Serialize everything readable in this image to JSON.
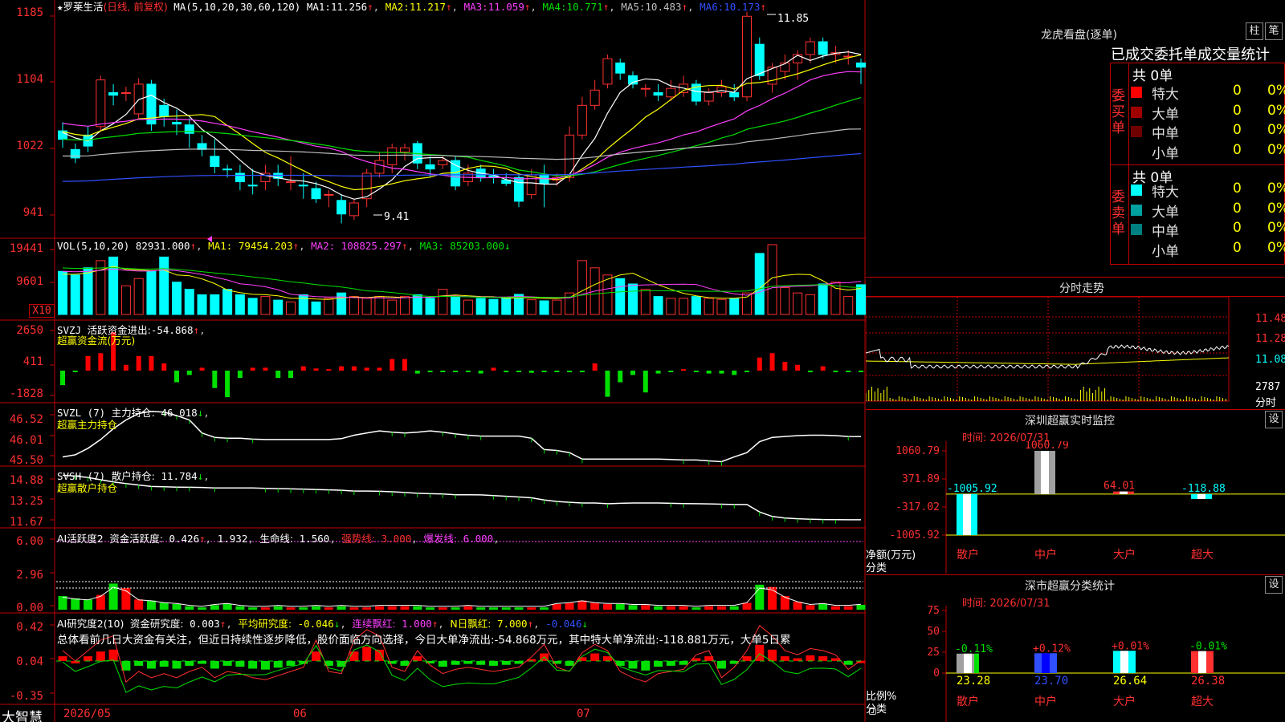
{
  "stock": {
    "star": "★",
    "name": "罗莱生活",
    "period": "(日线, 前复权)",
    "ma_params": "MA(5,10,20,30,60,120)",
    "ma": [
      {
        "label": "MA1:",
        "value": "11.256",
        "arrow": "↑",
        "color": "#ffffff"
      },
      {
        "label": "MA2:",
        "value": "11.217",
        "arrow": "↑",
        "color": "#ffff00"
      },
      {
        "label": "MA3:",
        "value": "11.059",
        "arrow": "↑",
        "color": "#ff40ff"
      },
      {
        "label": "MA4:",
        "value": "10.771",
        "arrow": "↑",
        "color": "#00e000"
      },
      {
        "label": "MA5:",
        "value": "10.483",
        "arrow": "↑",
        "color": "#c0c0c0"
      },
      {
        "label": "MA6:",
        "value": "10.173",
        "arrow": "↑",
        "color": "#3050ff"
      }
    ],
    "high_marker": "11.85",
    "low_marker": "9.41"
  },
  "price_axis": [
    "1185",
    "1104",
    "1022",
    "941"
  ],
  "vol": {
    "header": "VOL(5,10,20)",
    "value": "82931.000",
    "ma1": "79454.203",
    "ma2": "108825.297",
    "ma3": "85203.000",
    "axis": [
      "19441",
      "9601"
    ],
    "unit": "X10"
  },
  "svzj": {
    "header": "SVZJ",
    "label": "活跃资金进出:",
    "value": "-54.868",
    "sub": "超赢资金流(万元)",
    "axis": [
      "2650",
      "411",
      "-1828"
    ]
  },
  "svzl": {
    "header": "SVZL (7)",
    "label": "主力持仓:",
    "value": "46.018",
    "sub": "超赢主力持仓",
    "axis": [
      "46.52",
      "46.01",
      "45.50"
    ]
  },
  "svsh": {
    "header": "SVSH (7)",
    "label": "散户持仓:",
    "value": "11.784",
    "sub": "超赢散户持仓",
    "axis": [
      "14.88",
      "13.25",
      "11.67"
    ]
  },
  "ai_active": {
    "header": "AI活跃度2",
    "label": "资金活跃度:",
    "v1": "0.426",
    "v2": "1.932",
    "life_label": "生命线:",
    "life": "1.560",
    "strong_label": "强势线:",
    "strong": "3.000",
    "burst_label": "爆发线:",
    "burst": "6.000",
    "axis": [
      "6.00",
      "2.96",
      "0.00"
    ]
  },
  "ai_research": {
    "header": "AI研究度2(10)",
    "label": "资金研究度:",
    "v1": "0.003",
    "avg_label": "平均研究度:",
    "avg": "-0.046",
    "red_label": "连续飘红:",
    "red": "1.000",
    "nday_label": "N日飘红:",
    "nday": "7.000",
    "last": "-0.046",
    "comment": "总体看前几日大资金有关注，但近日持续性逐步降低，股价面临方向选择，今日大单净流出:-54.868万元，其中特大单净流出:-118.881万元，大单5日累",
    "axis": [
      "0.42",
      "0.04",
      "-0.35"
    ]
  },
  "date_axis": {
    "brand": "大智慧",
    "labels": [
      "2026/05",
      "06",
      "07"
    ]
  },
  "dragon": {
    "title": "龙虎看盘(逐单)",
    "btn1": "柱",
    "btn2": "笔",
    "tabs": "已成交委托单成交量统计",
    "buy_side": "委买单",
    "sell_side": "委卖单",
    "buy_total": "共 0单",
    "sell_total": "共 0单",
    "buy_rows": [
      {
        "name": "特大",
        "count": "0",
        "pct": "0%",
        "color": "#ff0000"
      },
      {
        "name": "大单",
        "count": "0",
        "pct": "0%",
        "color": "#a00000"
      },
      {
        "name": "中单",
        "count": "0",
        "pct": "0%",
        "color": "#700000"
      },
      {
        "name": "小单",
        "count": "0",
        "pct": "0%",
        "color": "#000000"
      }
    ],
    "sell_rows": [
      {
        "name": "特大",
        "count": "0",
        "pct": "0%",
        "color": "#00ffff"
      },
      {
        "name": "大单",
        "count": "0",
        "pct": "0%",
        "color": "#00a0a0"
      },
      {
        "name": "中单",
        "count": "0",
        "pct": "0%",
        "color": "#008080"
      },
      {
        "name": "小单",
        "count": "0",
        "pct": "0%",
        "color": "#000000"
      }
    ]
  },
  "intraday": {
    "title": "分时走势",
    "prices": [
      "11.48",
      "11.28",
      "11.08"
    ],
    "vol": "2787",
    "vol_unit": "分时"
  },
  "monitor": {
    "title": "深圳超赢实时监控",
    "btn": "设",
    "time_label": "时间:",
    "time": "2026/07/31",
    "axis": [
      "1060.79",
      "371.89",
      "-317.02",
      "-1005.92"
    ],
    "net_label": "净额(万元)",
    "cat_label": "分类",
    "categories": [
      "散户",
      "中户",
      "大户",
      "超大"
    ],
    "values": [
      "-1005.92",
      "1060.79",
      "64.01",
      "-118.88"
    ]
  },
  "classify": {
    "title": "深市超赢分类统计",
    "btn": "设",
    "time_label": "时间:",
    "time": "2026/07/31",
    "axis": [
      "75",
      "50",
      "25",
      "0"
    ],
    "ratio_label": "比例%",
    "cat_label": "分类",
    "categories": [
      "散户",
      "中户",
      "大户",
      "超大"
    ],
    "changes": [
      "-0.11%",
      "+0.12%",
      "+0.01%",
      "-0.01%"
    ],
    "values": [
      "23.28",
      "23.70",
      "26.64",
      "26.38"
    ]
  },
  "chart_data": [
    {
      "type": "candlestick",
      "title": "罗莱生活 (日线, 前复权)",
      "y_axis_ticks": [
        11.85,
        11.04,
        10.22,
        9.41
      ],
      "ylim": [
        9.3,
        11.9
      ],
      "candles": [
        [
          10.5,
          10.4,
          10.6,
          10.3
        ],
        [
          10.28,
          10.18,
          10.35,
          10.12
        ],
        [
          10.45,
          10.32,
          10.55,
          10.25
        ],
        [
          10.55,
          11.1,
          11.15,
          10.5
        ],
        [
          10.95,
          10.92,
          11.05,
          10.8
        ],
        [
          10.95,
          10.95,
          11.02,
          10.85
        ],
        [
          10.7,
          11.05,
          11.12,
          10.65
        ],
        [
          11.05,
          10.58,
          11.1,
          10.5
        ],
        [
          10.8,
          10.67,
          10.88,
          10.55
        ],
        [
          10.6,
          10.58,
          10.75,
          10.45
        ],
        [
          10.57,
          10.47,
          10.65,
          10.3
        ],
        [
          10.35,
          10.28,
          10.45,
          10.2
        ],
        [
          10.2,
          10.08,
          10.4,
          10.0
        ],
        [
          10.05,
          10.04,
          10.1,
          9.95
        ],
        [
          10.0,
          9.9,
          10.1,
          9.8
        ],
        [
          9.86,
          9.85,
          10.05,
          9.75
        ],
        [
          9.9,
          10.0,
          10.1,
          9.8
        ],
        [
          10.0,
          9.94,
          10.1,
          9.85
        ],
        [
          9.9,
          9.9,
          10.2,
          9.8
        ],
        [
          9.86,
          9.85,
          10.0,
          9.7
        ],
        [
          9.82,
          9.7,
          9.9,
          9.65
        ],
        [
          9.75,
          9.75,
          9.8,
          9.6
        ],
        [
          9.68,
          9.52,
          9.75,
          9.41
        ],
        [
          9.5,
          9.65,
          9.7,
          9.45
        ],
        [
          9.7,
          10.0,
          10.05,
          9.6
        ],
        [
          10.0,
          10.15,
          10.25,
          9.95
        ],
        [
          10.1,
          10.3,
          10.35,
          10.0
        ],
        [
          10.25,
          10.3,
          10.35,
          10.15
        ],
        [
          10.35,
          10.12,
          10.38,
          10.05
        ],
        [
          10.1,
          10.05,
          10.2,
          9.95
        ],
        [
          10.1,
          10.15,
          10.2,
          10.05
        ],
        [
          10.15,
          9.85,
          10.2,
          9.8
        ],
        [
          9.9,
          10.0,
          10.1,
          9.85
        ],
        [
          10.05,
          9.95,
          10.1,
          9.9
        ],
        [
          9.97,
          9.95,
          10.05,
          9.88
        ],
        [
          9.92,
          9.88,
          10.0,
          9.85
        ],
        [
          9.95,
          9.67,
          10.0,
          9.6
        ],
        [
          9.75,
          9.98,
          10.05,
          9.7
        ],
        [
          9.98,
          9.88,
          10.1,
          9.6
        ],
        [
          9.92,
          9.95,
          10.0,
          9.85
        ],
        [
          9.95,
          10.45,
          10.55,
          9.9
        ],
        [
          10.45,
          10.8,
          10.9,
          10.4
        ],
        [
          10.8,
          10.98,
          11.1,
          10.75
        ],
        [
          11.05,
          11.35,
          11.4,
          11.0
        ],
        [
          11.3,
          11.18,
          11.35,
          11.1
        ],
        [
          11.15,
          11.05,
          11.2,
          11.0
        ],
        [
          11.0,
          11.0,
          11.05,
          10.9
        ],
        [
          10.95,
          10.92,
          11.05,
          10.85
        ],
        [
          10.9,
          11.0,
          11.1,
          10.85
        ],
        [
          10.95,
          11.05,
          11.15,
          10.9
        ],
        [
          11.05,
          10.85,
          11.1,
          10.8
        ],
        [
          10.85,
          10.95,
          11.0,
          10.8
        ],
        [
          10.95,
          11.02,
          11.1,
          10.9
        ],
        [
          10.95,
          10.9,
          11.05,
          10.85
        ],
        [
          10.9,
          11.85,
          11.9,
          10.85
        ],
        [
          11.52,
          11.15,
          11.6,
          11.1
        ],
        [
          11.05,
          11.25,
          11.3,
          10.95
        ],
        [
          11.2,
          11.3,
          11.4,
          11.1
        ],
        [
          11.3,
          11.4,
          11.45,
          11.1
        ],
        [
          11.4,
          11.55,
          11.6,
          11.3
        ],
        [
          11.55,
          11.4,
          11.6,
          11.35
        ],
        [
          11.4,
          11.42,
          11.5,
          11.3
        ],
        [
          11.38,
          11.38,
          11.45,
          11.28
        ],
        [
          11.3,
          11.25,
          11.35,
          11.05
        ]
      ]
    },
    {
      "type": "bar",
      "title": "VOL(5,10,20)",
      "y_axis_ticks": [
        19441,
        9601
      ],
      "values": [
        12000,
        11000,
        13000,
        15000,
        16000,
        8000,
        10000,
        12000,
        16000,
        9000,
        7000,
        5500,
        5500,
        7000,
        5500,
        4500,
        5000,
        4000,
        3500,
        5500,
        3500,
        4500,
        6000,
        5000,
        4500,
        5000,
        4000,
        5000,
        5500,
        4500,
        7000,
        5000,
        4000,
        4500,
        4200,
        4800,
        5600,
        4100,
        3800,
        4000,
        6000,
        15000,
        13000,
        11000,
        10000,
        8500,
        7000,
        5000,
        4500,
        4500,
        5000,
        4500,
        4200,
        4500,
        6000,
        17000,
        19441,
        7500,
        6000,
        5500,
        8500,
        9000,
        5000,
        8293
      ]
    },
    {
      "type": "bar",
      "title": "SVZJ 活跃资金进出",
      "y_axis_ticks": [
        2650,
        411,
        -1828
      ],
      "values": [
        -1000,
        -100,
        1000,
        1200,
        2650,
        400,
        1000,
        1000,
        500,
        -800,
        -300,
        200,
        -1200,
        -1828,
        -500,
        200,
        200,
        -500,
        -500,
        300,
        150,
        100,
        300,
        300,
        200,
        200,
        800,
        800,
        -200,
        -100,
        -100,
        -100,
        -100,
        -200,
        200,
        -100,
        -100,
        -150,
        -100,
        -100,
        -100,
        -100,
        500,
        -1800,
        -800,
        -300,
        -1500,
        -200,
        -100,
        100,
        -100,
        -200,
        -200,
        -300,
        -100,
        900,
        1200,
        600,
        400,
        -100,
        300,
        -100,
        -100,
        -55
      ]
    },
    {
      "type": "line",
      "title": "SVZL (7) 主力持仓",
      "y_axis_ticks": [
        46.52,
        46.01,
        45.5
      ],
      "values": [
        45.55,
        45.6,
        45.75,
        45.95,
        46.2,
        46.4,
        46.55,
        46.6,
        46.58,
        46.5,
        46.4,
        46.1,
        46.0,
        45.98,
        45.98,
        45.96,
        45.95,
        45.95,
        45.95,
        45.95,
        45.95,
        45.95,
        45.97,
        46.05,
        46.1,
        46.15,
        46.12,
        46.1,
        46.12,
        46.15,
        46.12,
        46.08,
        46.05,
        46.03,
        46.03,
        46.03,
        46.03,
        45.98,
        45.72,
        45.7,
        45.65,
        45.5,
        45.5,
        45.5,
        45.5,
        45.5,
        45.5,
        45.5,
        45.49,
        45.48,
        45.48,
        45.46,
        45.44,
        45.55,
        45.65,
        45.9,
        46.0,
        46.02,
        46.04,
        46.05,
        46.05,
        46.04,
        46.02,
        46.018
      ]
    },
    {
      "type": "line",
      "title": "SVSH (7) 散户持仓",
      "y_axis_ticks": [
        14.88,
        13.25,
        11.67
      ],
      "values": [
        14.75,
        14.7,
        14.6,
        14.45,
        14.3,
        14.2,
        14.1,
        14.0,
        13.98,
        13.96,
        13.95,
        13.94,
        13.9,
        13.9,
        13.9,
        13.9,
        13.88,
        13.86,
        13.84,
        13.82,
        13.8,
        13.78,
        13.75,
        13.7,
        13.7,
        13.68,
        13.65,
        13.6,
        13.55,
        13.52,
        13.5,
        13.45,
        13.45,
        13.44,
        13.4,
        13.35,
        13.3,
        13.25,
        13.1,
        13.0,
        12.95,
        12.9,
        12.9,
        12.85,
        12.88,
        12.9,
        12.9,
        12.9,
        12.88,
        12.86,
        12.85,
        12.84,
        12.82,
        12.8,
        12.8,
        12.3,
        12.0,
        11.9,
        11.85,
        11.82,
        11.8,
        11.79,
        11.78,
        11.784
      ]
    },
    {
      "type": "bar",
      "title": "AI活跃度2 资金活跃度",
      "y_axis_ticks": [
        6.0,
        2.96,
        0.0
      ],
      "values": [
        1.2,
        1.0,
        0.9,
        1.3,
        2.3,
        1.9,
        0.9,
        0.8,
        0.6,
        0.5,
        0.3,
        0.2,
        0.4,
        0.5,
        0.3,
        0.2,
        0.2,
        0.3,
        0.2,
        0.2,
        0.3,
        0.2,
        0.3,
        0.2,
        0.2,
        0.3,
        0.3,
        0.3,
        0.3,
        0.2,
        0.2,
        0.2,
        0.3,
        0.2,
        0.2,
        0.2,
        0.2,
        0.2,
        0.2,
        0.5,
        0.6,
        0.8,
        0.6,
        0.5,
        0.5,
        0.4,
        0.4,
        0.3,
        0.3,
        0.3,
        0.2,
        0.3,
        0.3,
        0.3,
        0.6,
        2.2,
        2.0,
        1.2,
        0.7,
        0.4,
        0.5,
        0.3,
        0.3,
        0.426
      ]
    },
    {
      "type": "bar",
      "title": "AI研究度2(10) 资金研究度",
      "y_axis_ticks": [
        0.42,
        0.04,
        -0.35
      ],
      "values": [
        0.05,
        0.0,
        0.05,
        0.1,
        0.12,
        -0.1,
        -0.05,
        -0.08,
        -0.06,
        -0.08,
        -0.05,
        -0.03,
        -0.08,
        -0.05,
        -0.06,
        -0.08,
        -0.09,
        -0.07,
        -0.05,
        -0.03,
        0.1,
        -0.05,
        -0.06,
        0.1,
        0.15,
        0.12,
        -0.03,
        -0.05,
        0.05,
        -0.02,
        -0.06,
        -0.04,
        -0.03,
        -0.04,
        -0.05,
        -0.04,
        -0.03,
        0.02,
        0.08,
        -0.03,
        -0.05,
        0.04,
        0.08,
        0.05,
        -0.05,
        -0.08,
        -0.1,
        -0.06,
        -0.05,
        -0.04,
        0.03,
        0.05,
        -0.08,
        -0.03,
        0.05,
        0.17,
        0.12,
        0.05,
        0.03,
        0.06,
        0.05,
        0.03,
        -0.04,
        0.003
      ]
    },
    {
      "type": "bar",
      "title": "深圳超赢实时监控",
      "categories": [
        "散户",
        "中户",
        "大户",
        "超大"
      ],
      "values": [
        -1005.92,
        1060.79,
        64.01,
        -118.88
      ],
      "ylim": [
        -1005.92,
        1060.79
      ]
    },
    {
      "type": "bar",
      "title": "深市超赢分类统计",
      "categories": [
        "散户",
        "中户",
        "大户",
        "超大"
      ],
      "values": [
        23.28,
        23.7,
        26.64,
        26.38
      ],
      "ylim": [
        0,
        75
      ]
    }
  ]
}
